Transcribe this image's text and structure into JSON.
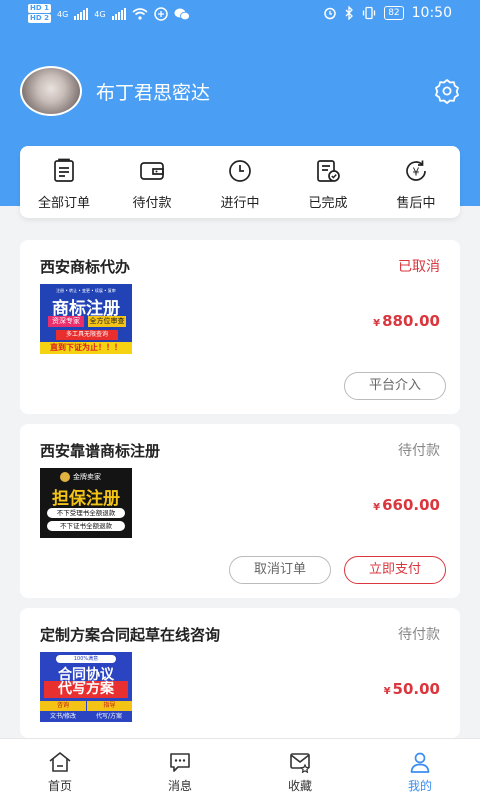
{
  "status_bar": {
    "hd1": "HD 1",
    "hd2": "HD 2",
    "net1": "4G",
    "net2": "4G",
    "battery": "82",
    "time": "10:50"
  },
  "profile": {
    "username": "布丁君思密达"
  },
  "order_menu": [
    {
      "label": "全部订单",
      "icon": "list-icon"
    },
    {
      "label": "待付款",
      "icon": "wallet-icon"
    },
    {
      "label": "进行中",
      "icon": "clock-icon"
    },
    {
      "label": "已完成",
      "icon": "completed-doc-icon"
    },
    {
      "label": "售后中",
      "icon": "refund-icon"
    }
  ],
  "orders": [
    {
      "title": "西安商标代办",
      "status": "已取消",
      "status_color": "#d9363e",
      "currency": "¥",
      "amount": "880.00",
      "thumb": {
        "top": "注册 • 转让 • 变更 • 续展 • 复审",
        "main": "商标注册",
        "tag1": "资深专家",
        "tag2": "全方位审查",
        "strip": "多工具无限查询",
        "bottom": "直到下证为止！！！"
      },
      "buttons": [
        "平台介入"
      ]
    },
    {
      "title": "西安靠谱商标注册",
      "status": "待付款",
      "status_color": "#888888",
      "currency": "¥",
      "amount": "660.00",
      "thumb": {
        "top": "金牌卖家",
        "main": "担保注册",
        "line1": "不下受理书全额退款",
        "line2": "不下证书全额退款"
      },
      "buttons": [
        "取消订单",
        "立即支付"
      ]
    },
    {
      "title": "定制方案合同起草在线咨询",
      "status": "待付款",
      "status_color": "#888888",
      "currency": "¥",
      "amount": "50.00",
      "thumb": {
        "top": "100%满意",
        "main1": "合同协议",
        "main2": "代写方案",
        "tag1": "咨询",
        "tag2": "指导",
        "foot1": "文书/修改",
        "foot2": "代写/方案"
      },
      "buttons": []
    }
  ],
  "tabbar": [
    {
      "label": "首页",
      "icon": "home-icon",
      "active": false
    },
    {
      "label": "消息",
      "icon": "message-icon",
      "active": false
    },
    {
      "label": "收藏",
      "icon": "favorite-icon",
      "active": false
    },
    {
      "label": "我的",
      "icon": "profile-icon",
      "active": true
    }
  ],
  "colors": {
    "header": "#4a9ff5",
    "accent": "#3b8ef0",
    "price": "#d9363e"
  }
}
